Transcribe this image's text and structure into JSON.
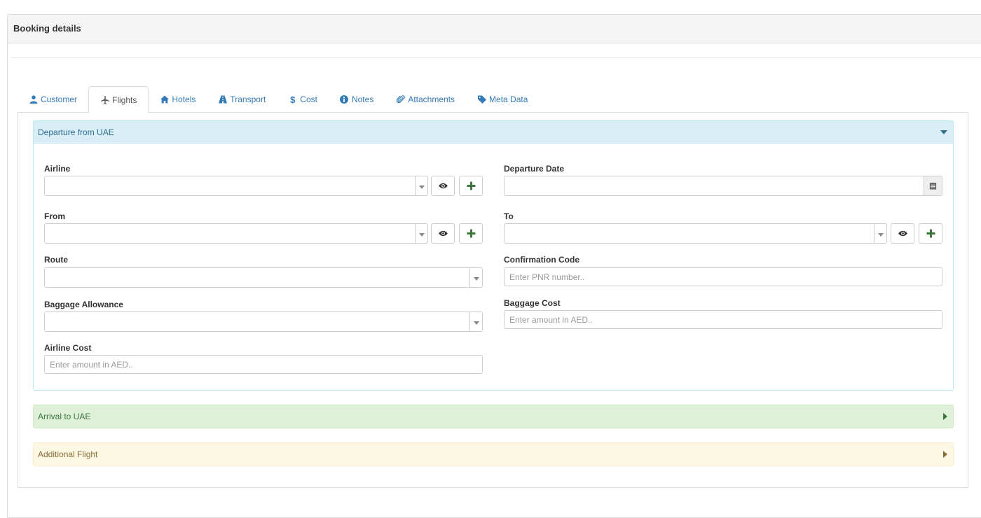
{
  "page": {
    "title": "Booking details"
  },
  "tabs": [
    {
      "label": "Customer",
      "icon": "user-icon"
    },
    {
      "label": "Flights",
      "icon": "plane-icon"
    },
    {
      "label": "Hotels",
      "icon": "home-icon"
    },
    {
      "label": "Transport",
      "icon": "road-icon"
    },
    {
      "label": "Cost",
      "icon": "dollar-icon"
    },
    {
      "label": "Notes",
      "icon": "info-icon"
    },
    {
      "label": "Attachments",
      "icon": "paperclip-icon"
    },
    {
      "label": "Meta Data",
      "icon": "tag-icon"
    }
  ],
  "active_tab": "Flights",
  "departure": {
    "header": "Departure from UAE",
    "airline_label": "Airline",
    "departure_date_label": "Departure Date",
    "from_label": "From",
    "to_label": "To",
    "route_label": "Route",
    "confirmation_label": "Confirmation Code",
    "confirmation_placeholder": "Enter PNR number..",
    "baggage_allowance_label": "Baggage Allowance",
    "baggage_cost_label": "Baggage Cost",
    "baggage_cost_placeholder": "Enter amount in AED..",
    "airline_cost_label": "Airline Cost",
    "airline_cost_placeholder": "Enter amount in AED.."
  },
  "arrival": {
    "header": "Arrival to UAE"
  },
  "additional": {
    "header": "Additional Flight"
  },
  "colors": {
    "link": "#337ab7",
    "info_panel": "#d9edf7",
    "success_panel": "#dff0d8",
    "warning_panel": "#fcf8e3",
    "plus_green": "#3c763d"
  }
}
